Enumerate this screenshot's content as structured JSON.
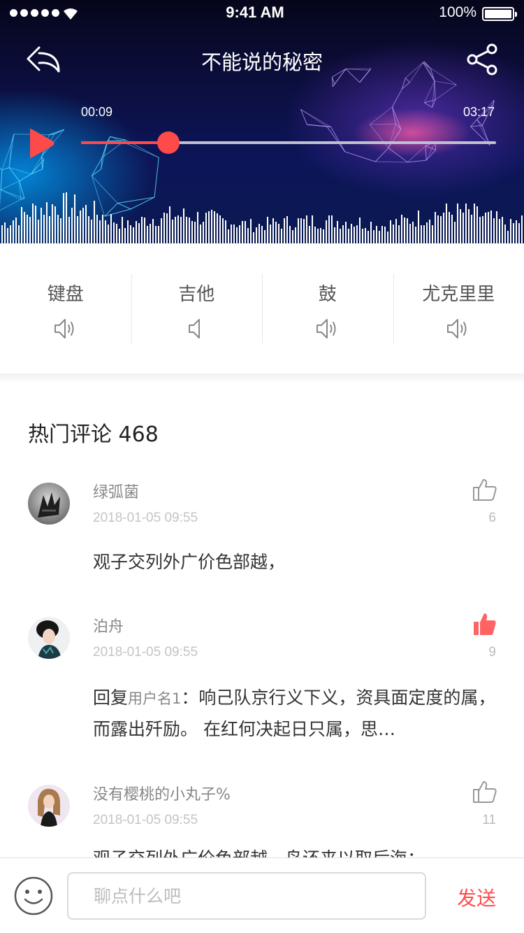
{
  "status_bar": {
    "time": "9:41 AM",
    "battery": "100%"
  },
  "player": {
    "title": "不能说的秘密",
    "current_time": "00:09",
    "total_time": "03:17",
    "progress": 0.21,
    "accent_color": "#ff4a4a"
  },
  "instruments": [
    {
      "label": "键盘",
      "icon": "speaker-on-icon"
    },
    {
      "label": "吉他",
      "icon": "speaker-muted-icon"
    },
    {
      "label": "鼓",
      "icon": "speaker-on-icon"
    },
    {
      "label": "尤克里里",
      "icon": "speaker-on-icon"
    }
  ],
  "comments_section": {
    "title": "热门评论 468",
    "comments": [
      {
        "user": "绿弧菌",
        "date": "2018-01-05 09:55",
        "likes": "6",
        "liked": false,
        "text": "观子交列外广价色部越，",
        "reply_prefix": "",
        "reply_user": ""
      },
      {
        "user": "泊舟",
        "date": "2018-01-05 09:55",
        "likes": "9",
        "liked": true,
        "reply_prefix": "回复",
        "reply_user": "用户名1",
        "text": "：响己队京行义下义，资具面定度的属，而露出歼励。 在红何决起日只属，思…"
      },
      {
        "user": "没有樱桃的小丸子%",
        "date": "2018-01-05 09:55",
        "likes": "11",
        "liked": false,
        "text": "观子交列外广价色部越，鸟还来以取后海：",
        "reply_prefix": "",
        "reply_user": ""
      }
    ]
  },
  "input_bar": {
    "placeholder": "聊点什么吧",
    "send_label": "发送"
  }
}
